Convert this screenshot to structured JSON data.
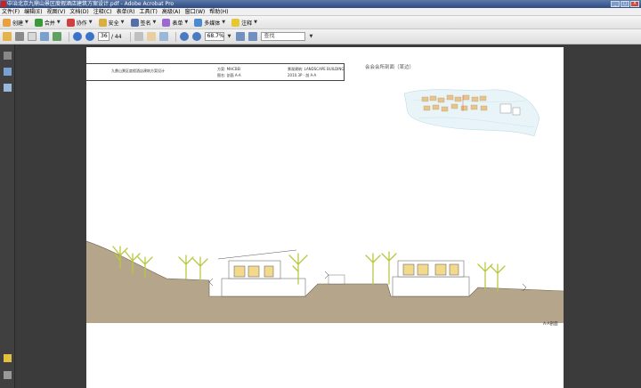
{
  "window": {
    "title": "中冶北京九鼎山景区度假酒店建筑方案设计.pdf - Adobe Acrobat Pro",
    "buttons": [
      "_",
      "□",
      "X"
    ]
  },
  "menu": [
    "文件(F)",
    "编辑(E)",
    "视图(V)",
    "文档(D)",
    "注释(C)",
    "表单(R)",
    "工具(T)",
    "高级(A)",
    "窗口(W)",
    "帮助(H)"
  ],
  "toolbar": {
    "create": "创建",
    "combine": "合并",
    "collaborate": "协作",
    "secure": "安全",
    "sign": "签名",
    "forms": "表单",
    "multimedia": "多媒体",
    "comment": "注释"
  },
  "nav": {
    "page_current": "36",
    "page_total": "/ 44",
    "zoom": "68.7%",
    "find_placeholder": "查找"
  },
  "document": {
    "project_name": "九鼎山景区度假酒店建筑方案设计",
    "designer_line1": "方案: MHCBEI",
    "designer_line2": "图名: 剖面 A-A",
    "design_line1": "景观建筑: LANDSCAPE BUILDING",
    "design_line2": "2010.3P · 剖 A-A",
    "sheet_title": "会会会所剖面（某边）",
    "section_label": "A-A剖面"
  },
  "colors": {
    "ground": "#b5a58a",
    "tree": "#b8c840",
    "accent": "#2b4f86"
  }
}
